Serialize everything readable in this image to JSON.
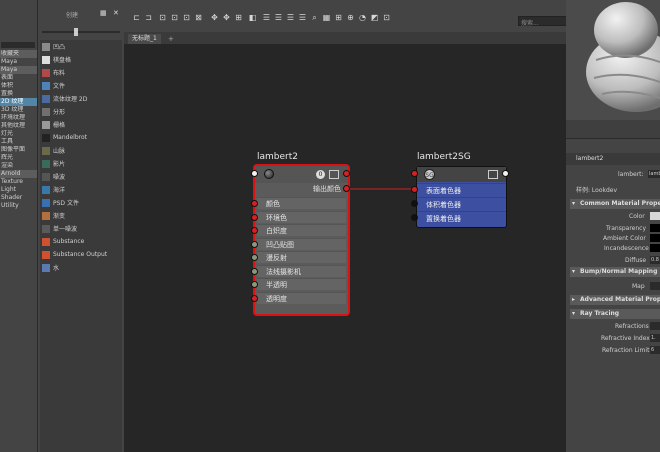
{
  "left_panel": {
    "items": [
      {
        "label": "收藏夹",
        "selected": false,
        "header": true
      },
      {
        "label": "Maya",
        "selected": false,
        "header": false
      },
      {
        "label": "Maya",
        "selected": false,
        "header": true
      },
      {
        "label": "表面",
        "selected": false,
        "header": false
      },
      {
        "label": "体积",
        "selected": false,
        "header": false
      },
      {
        "label": "置换",
        "selected": false,
        "header": false
      },
      {
        "label": "2D 纹理",
        "selected": true,
        "header": false
      },
      {
        "label": "3D 纹理",
        "selected": false,
        "header": false
      },
      {
        "label": "环境纹理",
        "selected": false,
        "header": false
      },
      {
        "label": "其他纹理",
        "selected": false,
        "header": false
      },
      {
        "label": "灯光",
        "selected": false,
        "header": false
      },
      {
        "label": "工具",
        "selected": false,
        "header": false
      },
      {
        "label": "图像平面",
        "selected": false,
        "header": false
      },
      {
        "label": "辉光",
        "selected": false,
        "header": false
      },
      {
        "label": "渲染",
        "selected": false,
        "header": false
      },
      {
        "label": "Arnold",
        "selected": false,
        "header": true
      },
      {
        "label": "Texture",
        "selected": false,
        "header": false
      },
      {
        "label": "Light",
        "selected": false,
        "header": false
      },
      {
        "label": "Shader",
        "selected": false,
        "header": false
      },
      {
        "label": "Utility",
        "selected": false,
        "header": false
      }
    ]
  },
  "create_panel": {
    "title": "创建",
    "items": [
      {
        "label": "凹凸",
        "icon": "bump-icon"
      },
      {
        "label": "棋盘格",
        "icon": "checker-icon"
      },
      {
        "label": "布料",
        "icon": "cloth-icon"
      },
      {
        "label": "文件",
        "icon": "file-icon"
      },
      {
        "label": "流体纹理 2D",
        "icon": "fluid-texture-icon"
      },
      {
        "label": "分形",
        "icon": "fractal-icon"
      },
      {
        "label": "栅格",
        "icon": "grid-icon"
      },
      {
        "label": "Mandelbrot",
        "icon": "mandelbrot-icon"
      },
      {
        "label": "山脉",
        "icon": "mountain-icon"
      },
      {
        "label": "影片",
        "icon": "movie-icon"
      },
      {
        "label": "噪波",
        "icon": "noise-icon"
      },
      {
        "label": "海洋",
        "icon": "ocean-icon"
      },
      {
        "label": "PSD 文件",
        "icon": "psd-file-icon"
      },
      {
        "label": "渐变",
        "icon": "ramp-icon"
      },
      {
        "label": "单一噪波",
        "icon": "simplex-noise-icon"
      },
      {
        "label": "Substance",
        "icon": "substance-icon"
      },
      {
        "label": "Substance Output",
        "icon": "substance-output-icon"
      },
      {
        "label": "水",
        "icon": "water-icon"
      }
    ]
  },
  "toolbar": {
    "search_placeholder": "搜索..."
  },
  "tabs": [
    {
      "label": "无标题_1"
    },
    {
      "label": "+"
    }
  ],
  "graph": {
    "lambert_node": {
      "title": "lambert2",
      "count_badge": "0",
      "output_label": "输出颜色",
      "attributes": [
        {
          "label": "颜色",
          "port": "red"
        },
        {
          "label": "环境色",
          "port": "red"
        },
        {
          "label": "白炽度",
          "port": "red"
        },
        {
          "label": "凹凸贴图",
          "port": "green"
        },
        {
          "label": "漫反射",
          "port": "green"
        },
        {
          "label": "法线摄影机",
          "port": "green"
        },
        {
          "label": "半透明",
          "port": "green"
        },
        {
          "label": "透明度",
          "port": "red"
        }
      ]
    },
    "sg_node": {
      "title": "lambert2SG",
      "attributes": [
        {
          "label": "表面着色器",
          "port": "red"
        },
        {
          "label": "体积着色器",
          "port": "black"
        },
        {
          "label": "置换着色器",
          "port": "black"
        }
      ]
    },
    "colors": {
      "selection": "#dd1111",
      "shading_group": "#3c4fa0",
      "connection": "#cc2222"
    }
  },
  "attribute_editor": {
    "tab": "lambert2",
    "lambert_label": "lambert:",
    "lambert_value": "lamb",
    "sample_label": "样例: Lookdev",
    "sections": [
      {
        "label": "Common Material Properties"
      },
      {
        "label": "Bump/Normal Mapping"
      },
      {
        "label": "Advanced Material Properties"
      },
      {
        "label": "Ray Tracing"
      }
    ],
    "common": [
      {
        "label": "Color"
      },
      {
        "label": "Transparency"
      },
      {
        "label": "Ambient Color"
      },
      {
        "label": "Incandescence"
      },
      {
        "label": "Diffuse",
        "value": "0.8"
      }
    ],
    "map_label": "Map",
    "ray": [
      {
        "label": "Refractions"
      },
      {
        "label": "Refractive Index",
        "value": "1."
      },
      {
        "label": "Refraction Limit",
        "value": "6"
      }
    ]
  }
}
